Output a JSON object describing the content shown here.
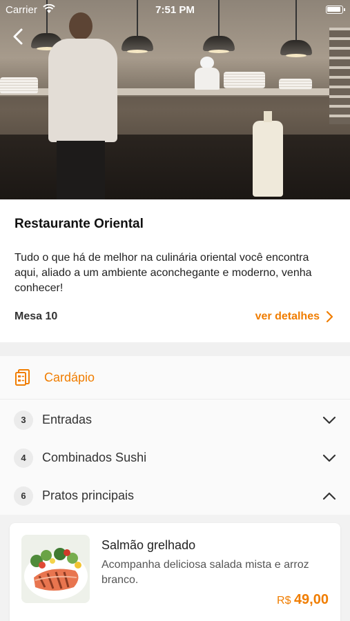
{
  "status_bar": {
    "carrier": "Carrier",
    "time": "7:51 PM"
  },
  "restaurant": {
    "name": "Restaurante Oriental",
    "description": "Tudo o que há de melhor na culinária oriental você encontra aqui, aliado a um ambiente aconchegante e moderno, venha conhecer!",
    "table": "Mesa 10",
    "details_link": "ver detalhes"
  },
  "menu": {
    "title": "Cardápio",
    "categories": [
      {
        "count": "3",
        "name": "Entradas",
        "expanded": false
      },
      {
        "count": "4",
        "name": "Combinados Sushi",
        "expanded": false
      },
      {
        "count": "6",
        "name": "Pratos principais",
        "expanded": true
      }
    ]
  },
  "dishes": [
    {
      "name": "Salmão grelhado",
      "description": "Acompanha deliciosa salada mista e arroz branco.",
      "currency": "R$",
      "price": "49,00"
    }
  ],
  "colors": {
    "accent": "#f07d00",
    "background": "#ffffff",
    "section_gap": "#f0f0f0"
  },
  "icons": [
    "back-icon",
    "wifi-icon",
    "battery-icon",
    "menu-document-icon",
    "chevron-right-icon",
    "chevron-down-icon",
    "chevron-up-icon"
  ]
}
